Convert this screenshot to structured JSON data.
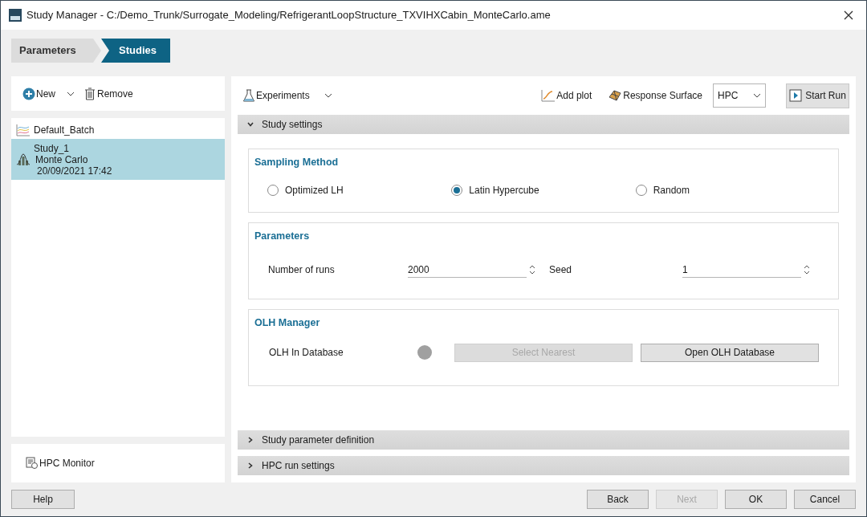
{
  "window": {
    "title": "Study Manager - C:/Demo_Trunk/Surrogate_Modeling/RefrigerantLoopStructure_TXVIHXCabin_MonteCarlo.ame"
  },
  "breadcrumb": [
    {
      "label": "Parameters",
      "selected": false
    },
    {
      "label": "Studies",
      "selected": true
    }
  ],
  "left_toolbar": {
    "new": "New",
    "remove": "Remove"
  },
  "studies": [
    {
      "kind": "batch",
      "lines": [
        "Default_Batch"
      ],
      "selected": false
    },
    {
      "kind": "study",
      "lines": [
        "Study_1",
        "Monte Carlo",
        "20/09/2021 17:42"
      ],
      "selected": true
    }
  ],
  "hpc_monitor": "HPC Monitor",
  "toolbar": {
    "experiments": "Experiments",
    "add_plot": "Add plot",
    "response_surface": "Response Surface",
    "run_target": "HPC",
    "start_run": "Start Run"
  },
  "sections": [
    {
      "title": "Study settings",
      "expanded": true
    },
    {
      "title": "Study parameter definition",
      "expanded": false
    },
    {
      "title": "HPC run settings",
      "expanded": false
    }
  ],
  "sampling_method": {
    "title": "Sampling Method",
    "options": [
      {
        "label": "Optimized LH",
        "selected": false
      },
      {
        "label": "Latin Hypercube",
        "selected": true
      },
      {
        "label": "Random",
        "selected": false
      }
    ]
  },
  "parameters": {
    "title": "Parameters",
    "fields": [
      {
        "label": "Number of runs",
        "value": "2000"
      },
      {
        "label": "Seed",
        "value": "1"
      }
    ]
  },
  "olh_manager": {
    "title": "OLH Manager",
    "label": "OLH In Database",
    "buttons": [
      {
        "label": "Select Nearest",
        "disabled": true
      },
      {
        "label": "Open OLH Database",
        "disabled": false
      }
    ]
  },
  "footer": {
    "help": "Help",
    "buttons": [
      {
        "label": "Back",
        "disabled": false
      },
      {
        "label": "Next",
        "disabled": true
      },
      {
        "label": "OK",
        "disabled": false
      },
      {
        "label": "Cancel",
        "disabled": false
      }
    ]
  }
}
